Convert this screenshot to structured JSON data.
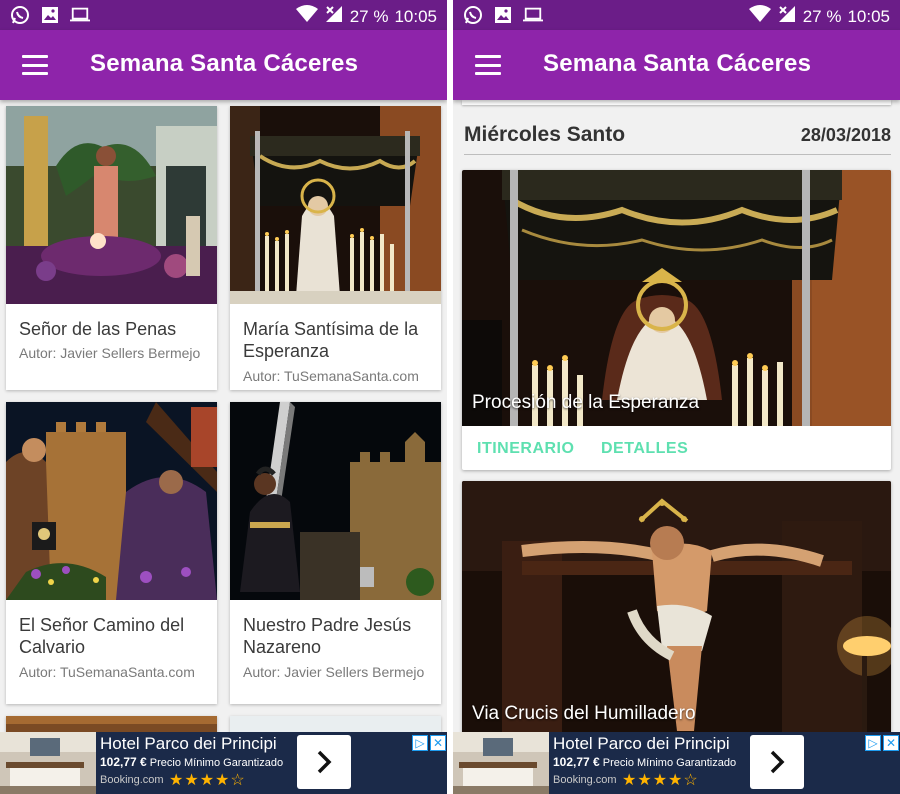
{
  "colors": {
    "status_bar": "#6b1d88",
    "app_bar": "#8e24aa",
    "accent_action": "#5ee0b0",
    "background": "#f1f1f1",
    "ad_background": "#1b2a49"
  },
  "status_bar": {
    "icons": [
      "whatsapp-icon",
      "gallery-icon",
      "laptop-icon"
    ],
    "battery": "27 %",
    "time": "10:05"
  },
  "app_bar": {
    "title": "Semana Santa Cáceres",
    "menu_icon": "hamburger-menu-icon"
  },
  "grid": {
    "cards": [
      {
        "title": "Señor de las Penas",
        "author": "Autor: Javier Sellers Bermejo"
      },
      {
        "title": "María Santísima de la Esperanza",
        "author": "Autor: TuSemanaSanta.com"
      },
      {
        "title": "El Señor Camino del Calvario",
        "author": "Autor: TuSemanaSanta.com"
      },
      {
        "title": "Nuestro Padre Jesús Nazareno",
        "author": "Autor: Javier Sellers Bermejo"
      }
    ]
  },
  "day": {
    "name": "Miércoles Santo",
    "date": "28/03/2018"
  },
  "processions": [
    {
      "caption": "Procesión de la Esperanza",
      "action_route": "ITINERARIO",
      "action_details": "DETALLES"
    },
    {
      "caption": "Via Crucis del Humilladero"
    }
  ],
  "ad": {
    "title": "Hotel Parco dei Principi",
    "price": "102,77 €",
    "price_note": "Precio Mínimo Garantizado",
    "source": "Booking.com",
    "rating_stars": 4,
    "stars_text": "★★★★☆",
    "arrow_icon": "chevron-right-icon",
    "adchoices": [
      "▷",
      "✕"
    ]
  }
}
